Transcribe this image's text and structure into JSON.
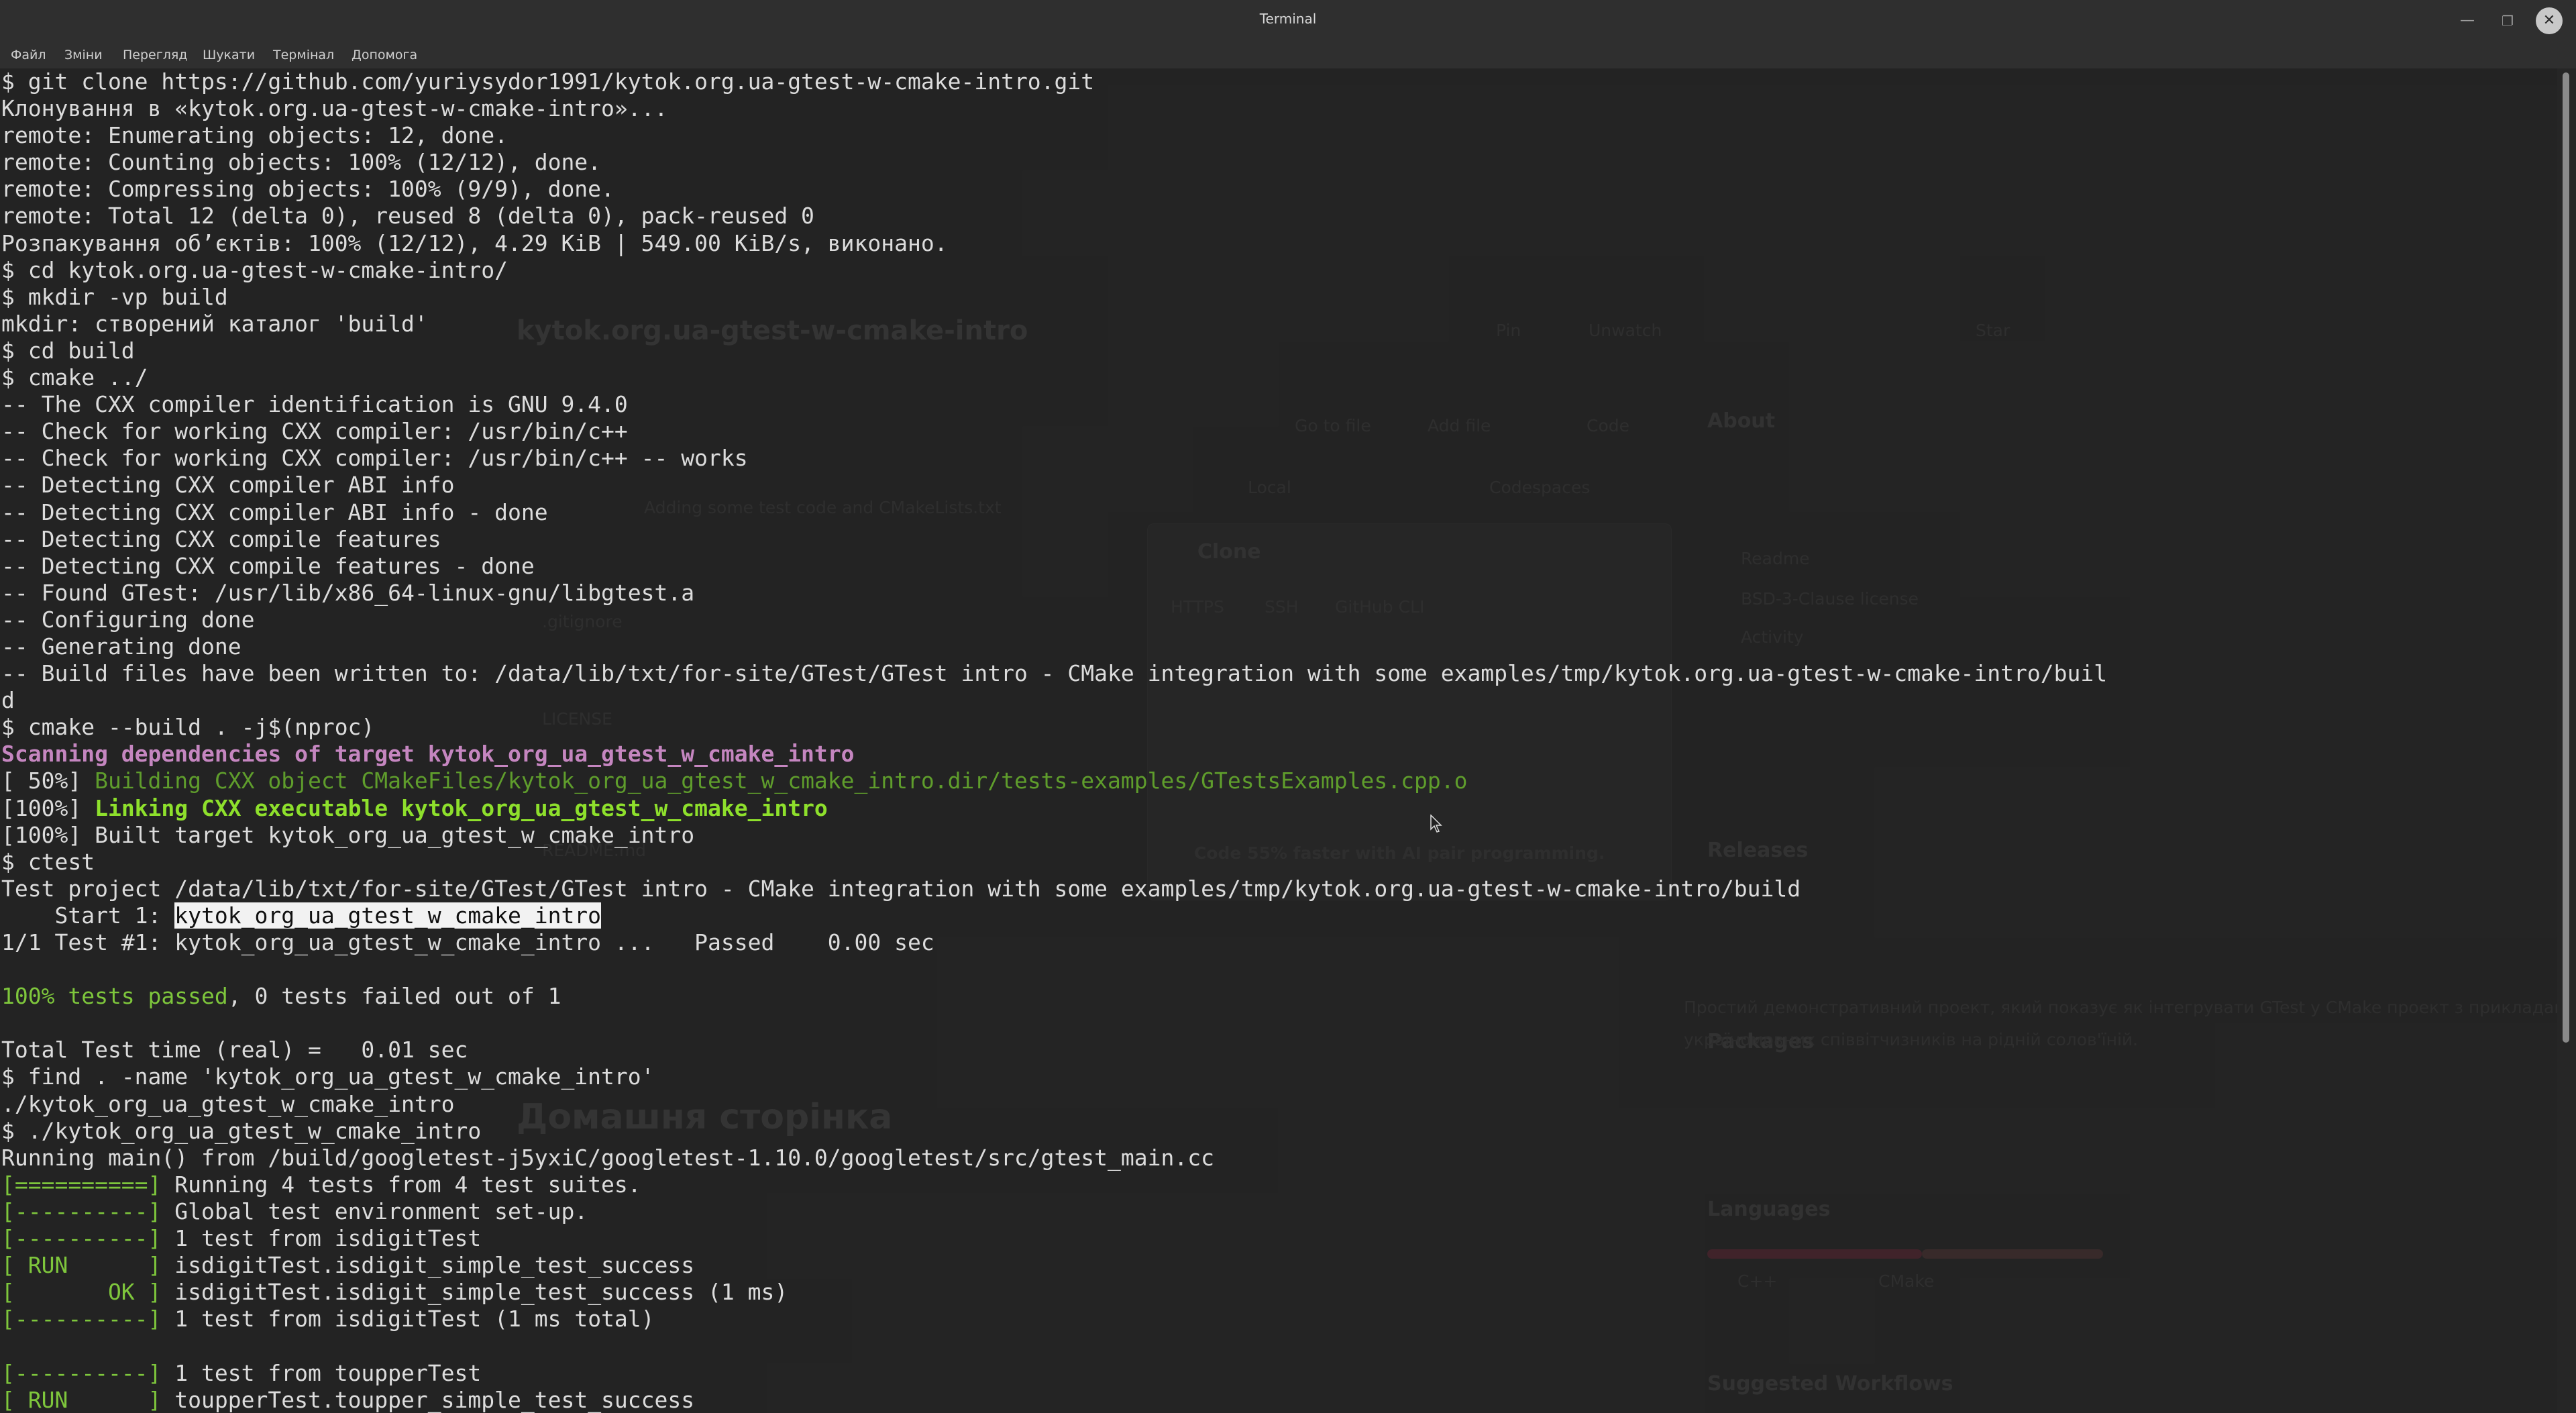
{
  "window": {
    "title": "Terminal",
    "minimize_glyph": "—",
    "maximize_glyph": "❐",
    "close_glyph": "✕"
  },
  "menu": {
    "file": "Файл",
    "edit": "Зміни",
    "view": "Перегляд",
    "search": "Шукати",
    "terminal": "Термінал",
    "help": "Допомога"
  },
  "terminal": {
    "lines": [
      {
        "segments": [
          {
            "t": "$ git clone https://github.com/yuriysydor1991/kytok.org.ua-gtest-w-cmake-intro.git"
          }
        ]
      },
      {
        "segments": [
          {
            "t": "Клонування в «kytok.org.ua-gtest-w-cmake-intro»..."
          }
        ]
      },
      {
        "segments": [
          {
            "t": "remote: Enumerating objects: 12, done."
          }
        ]
      },
      {
        "segments": [
          {
            "t": "remote: Counting objects: 100% (12/12), done."
          }
        ]
      },
      {
        "segments": [
          {
            "t": "remote: Compressing objects: 100% (9/9), done."
          }
        ]
      },
      {
        "segments": [
          {
            "t": "remote: Total 12 (delta 0), reused 8 (delta 0), pack-reused 0"
          }
        ]
      },
      {
        "segments": [
          {
            "t": "Розпакування об’єктів: 100% (12/12), 4.29 KiB | 549.00 KiB/s, виконано."
          }
        ]
      },
      {
        "segments": [
          {
            "t": "$ cd kytok.org.ua-gtest-w-cmake-intro/"
          }
        ]
      },
      {
        "segments": [
          {
            "t": "$ mkdir -vp build"
          }
        ]
      },
      {
        "segments": [
          {
            "t": "mkdir: створений каталог 'build'"
          }
        ]
      },
      {
        "segments": [
          {
            "t": "$ cd build"
          }
        ]
      },
      {
        "segments": [
          {
            "t": "$ cmake ../"
          }
        ]
      },
      {
        "segments": [
          {
            "t": "-- The CXX compiler identification is GNU 9.4.0"
          }
        ]
      },
      {
        "segments": [
          {
            "t": "-- Check for working CXX compiler: /usr/bin/c++"
          }
        ]
      },
      {
        "segments": [
          {
            "t": "-- Check for working CXX compiler: /usr/bin/c++ -- works"
          }
        ]
      },
      {
        "segments": [
          {
            "t": "-- Detecting CXX compiler ABI info"
          }
        ]
      },
      {
        "segments": [
          {
            "t": "-- Detecting CXX compiler ABI info - done"
          }
        ]
      },
      {
        "segments": [
          {
            "t": "-- Detecting CXX compile features"
          }
        ]
      },
      {
        "segments": [
          {
            "t": "-- Detecting CXX compile features - done"
          }
        ]
      },
      {
        "segments": [
          {
            "t": "-- Found GTest: /usr/lib/x86_64-linux-gnu/libgtest.a"
          }
        ]
      },
      {
        "segments": [
          {
            "t": "-- Configuring done"
          }
        ]
      },
      {
        "segments": [
          {
            "t": "-- Generating done"
          }
        ]
      },
      {
        "segments": [
          {
            "t": "-- Build files have been written to: /data/lib/txt/for-site/GTest/GTest intro - CMake integration with some examples/tmp/kytok.org.ua-gtest-w-cmake-intro/buil"
          }
        ]
      },
      {
        "segments": [
          {
            "t": "d"
          }
        ]
      },
      {
        "segments": [
          {
            "t": "$ cmake --build . -j$(nproc)"
          }
        ]
      },
      {
        "segments": [
          {
            "t": "Scanning dependencies of target kytok_org_ua_gtest_w_cmake_intro",
            "c": "c-magenta"
          }
        ]
      },
      {
        "segments": [
          {
            "t": "[ 50%] "
          },
          {
            "t": "Building CXX object CMakeFiles/kytok_org_ua_gtest_w_cmake_intro.dir/tests-examples/GTestsExamples.cpp.o",
            "c": "c-dim-green"
          }
        ]
      },
      {
        "segments": [
          {
            "t": "[100%] "
          },
          {
            "t": "Linking CXX executable kytok_org_ua_gtest_w_cmake_intro",
            "c": "c-green-b"
          }
        ]
      },
      {
        "segments": [
          {
            "t": "[100%] Built target kytok_org_ua_gtest_w_cmake_intro"
          }
        ]
      },
      {
        "segments": [
          {
            "t": "$ ctest"
          }
        ]
      },
      {
        "segments": [
          {
            "t": "Test project /data/lib/txt/for-site/GTest/GTest intro - CMake integration with some examples/tmp/kytok.org.ua-gtest-w-cmake-intro/build"
          }
        ]
      },
      {
        "segments": [
          {
            "t": "    Start 1: "
          },
          {
            "t": "kytok_org_ua_gtest_w_cmake_intro",
            "c": "hl"
          }
        ]
      },
      {
        "segments": [
          {
            "t": "1/1 Test #1: kytok_org_ua_gtest_w_cmake_intro ...   Passed    0.00 sec"
          }
        ]
      },
      {
        "segments": [
          {
            "t": ""
          }
        ]
      },
      {
        "segments": [
          {
            "t": "100% tests passed",
            "c": "c-pass"
          },
          {
            "t": ", 0 tests failed out of 1"
          }
        ]
      },
      {
        "segments": [
          {
            "t": ""
          }
        ]
      },
      {
        "segments": [
          {
            "t": "Total Test time (real) =   0.01 sec"
          }
        ]
      },
      {
        "segments": [
          {
            "t": "$ find . -name 'kytok_org_ua_gtest_w_cmake_intro'"
          }
        ]
      },
      {
        "segments": [
          {
            "t": "./kytok_org_ua_gtest_w_cmake_intro"
          }
        ]
      },
      {
        "segments": [
          {
            "t": "$ ./kytok_org_ua_gtest_w_cmake_intro"
          }
        ]
      },
      {
        "segments": [
          {
            "t": "Running main() from /build/googletest-j5yxiC/googletest-1.10.0/googletest/src/gtest_main.cc"
          }
        ]
      },
      {
        "segments": [
          {
            "t": "[==========]",
            "c": "c-green"
          },
          {
            "t": " Running 4 tests from 4 test suites."
          }
        ]
      },
      {
        "segments": [
          {
            "t": "[----------]",
            "c": "c-green"
          },
          {
            "t": " Global test environment set-up."
          }
        ]
      },
      {
        "segments": [
          {
            "t": "[----------]",
            "c": "c-green"
          },
          {
            "t": " 1 test from isdigitTest"
          }
        ]
      },
      {
        "segments": [
          {
            "t": "[ RUN      ]",
            "c": "c-green"
          },
          {
            "t": " isdigitTest.isdigit_simple_test_success"
          }
        ]
      },
      {
        "segments": [
          {
            "t": "[       OK ]",
            "c": "c-green"
          },
          {
            "t": " isdigitTest.isdigit_simple_test_success (1 ms)"
          }
        ]
      },
      {
        "segments": [
          {
            "t": "[----------]",
            "c": "c-green"
          },
          {
            "t": " 1 test from isdigitTest (1 ms total)"
          }
        ]
      },
      {
        "segments": [
          {
            "t": ""
          }
        ]
      },
      {
        "segments": [
          {
            "t": "[----------]",
            "c": "c-green"
          },
          {
            "t": " 1 test from toupperTest"
          }
        ]
      },
      {
        "segments": [
          {
            "t": "[ RUN      ]",
            "c": "c-green"
          },
          {
            "t": " toupperTest.toupper_simple_test_success"
          }
        ]
      }
    ]
  },
  "ghost": {
    "repo_title": "kytok.org.ua-gtest-w-cmake-intro",
    "about": "About",
    "releases": "Releases",
    "packages": "Packages",
    "languages": "Languages",
    "suggested": "Suggested Workflows",
    "homepage": "Домашня сторінка",
    "clone": "Clone",
    "https": "HTTPS",
    "ssh": "SSH",
    "github_cli": "GitHub CLI",
    "local": "Local",
    "codespaces": "Codespaces",
    "go_to_file": "Go to file",
    "add_file": "Add file",
    "code": "Code",
    "pin": "Pin",
    "unwatch": "Unwatch",
    "star": "Star",
    "readme": "Readme",
    "license_label": "BSD-3-Clause license",
    "activity": "Activity",
    "gitignore": ".gitignore",
    "license_file": "LICENSE",
    "readme_file": "README.md",
    "commit_msg": "Adding some test code and CMakeLists.txt",
    "copilot": "Code 55% faster with AI pair programming.",
    "desc": "Простий демонстративний проект, який показує як інтегрувати GTest у CMake проект з прикладами для",
    "desc2": "україномовних співвітчизників на рідній солов'їній.",
    "cpp": "C++",
    "cmake": "CMake",
    "accent_color": "#238636"
  }
}
